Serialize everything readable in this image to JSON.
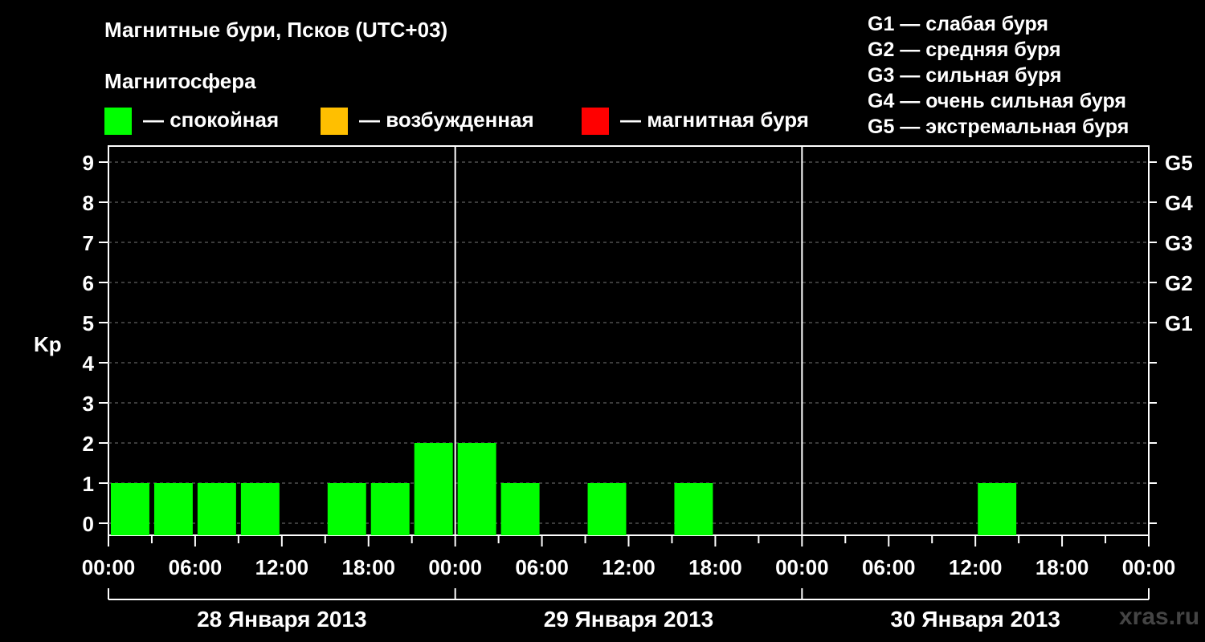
{
  "title": "Магнитные бури, Псков (UTC+03)",
  "subtitle": "Магнитосфера",
  "legend": [
    {
      "label": "— спокойная",
      "color": "#00ff00"
    },
    {
      "label": "— возбужденная",
      "color": "#ffbf00"
    },
    {
      "label": "— магнитная буря",
      "color": "#ff0000"
    }
  ],
  "g_scale": [
    "G1 — слабая буря",
    "G2 — средняя буря",
    "G3 — сильная буря",
    "G4 — очень сильная буря",
    "G5 — экстремальная буря"
  ],
  "watermark": "xras.ru",
  "chart_data": {
    "type": "bar",
    "ylabel": "Kp",
    "ylim": [
      0,
      9
    ],
    "yticks": [
      "0",
      "1",
      "2",
      "3",
      "4",
      "5",
      "6",
      "7",
      "8",
      "9"
    ],
    "right_ticks": [
      {
        "kp": 5,
        "label": "G1"
      },
      {
        "kp": 6,
        "label": "G2"
      },
      {
        "kp": 7,
        "label": "G3"
      },
      {
        "kp": 8,
        "label": "G4"
      },
      {
        "kp": 9,
        "label": "G5"
      }
    ],
    "xtick_labels": [
      "00:00",
      "06:00",
      "12:00",
      "18:00",
      "00:00",
      "06:00",
      "12:00",
      "18:00",
      "00:00",
      "06:00",
      "12:00",
      "18:00",
      "00:00"
    ],
    "days": [
      "28 Января 2013",
      "29 Января 2013",
      "30 Января 2013"
    ],
    "interval_hours": 3,
    "values": [
      1,
      1,
      1,
      1,
      null,
      1,
      1,
      2,
      2,
      1,
      null,
      1,
      null,
      1,
      null,
      null,
      null,
      null,
      null,
      null,
      1,
      null,
      null,
      null
    ],
    "colors": {
      "quiet": "#00ff00"
    },
    "grid": true
  }
}
